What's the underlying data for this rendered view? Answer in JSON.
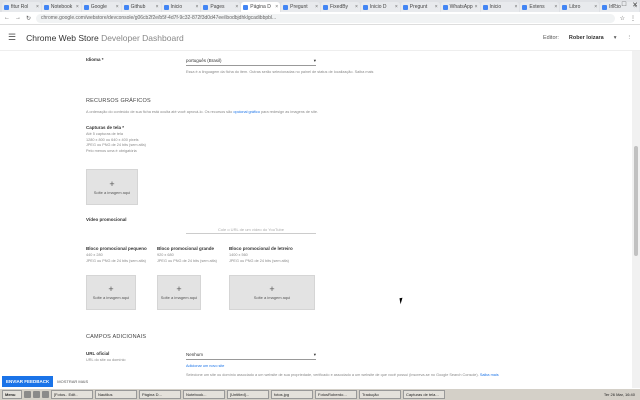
{
  "browser": {
    "tabs": [
      {
        "label": "fitur Rol",
        "active": false
      },
      {
        "label": "Notebook",
        "active": false
      },
      {
        "label": "Google",
        "active": false
      },
      {
        "label": "Github",
        "active": false
      },
      {
        "label": "Inicio",
        "active": false
      },
      {
        "label": "Pages",
        "active": false
      },
      {
        "label": "Página D",
        "active": true
      },
      {
        "label": "Pregunt",
        "active": false
      },
      {
        "label": "FixedBy",
        "active": false
      },
      {
        "label": "Inicio D",
        "active": false
      },
      {
        "label": "Pregunt",
        "active": false
      },
      {
        "label": "WhatsApp",
        "active": false
      },
      {
        "label": "Inicio",
        "active": false
      },
      {
        "label": "Extens",
        "active": false
      },
      {
        "label": "Libro",
        "active": false
      },
      {
        "label": "Inicio",
        "active": false
      }
    ],
    "url": "chrome.google.com/webstore/devconsole/g06cb2f2e/b5f-4d7f-9c32-872f3d0d47ee/ibodbjdhklgcadibbpbl..."
  },
  "header": {
    "app_title": "Chrome Web Store",
    "app_subtitle": "Developer Dashboard",
    "publisher_label": "Editor:",
    "user_name": "Rober loizara",
    "more_icon": "more-vert-icon"
  },
  "language": {
    "label": "Idioma *",
    "value": "português (Brasil)",
    "help": "Essa é a linguagem da ficha do item. Outras serão selecionadas no painel de status de localização. Saiba mais"
  },
  "graphics": {
    "section_title": "RECURSOS GRÁFICOS",
    "hint_prefix": "A ordenação do conteúdo de sua ficha está oculta até você aprová-lo. Os recursos são",
    "hint_link": "opcional gráfico",
    "hint_suffix": "para redesign as imagens de site.",
    "screenshots": {
      "label": "Capturas de tela *",
      "details": [
        "Até 5 capturas de tela",
        "1280 x 800 ou 640 x 400 pixels",
        "JPEG ou PNG de 24 bits (sem alfa)",
        "Pelo menos uma é obrigatória"
      ],
      "upload_label": "Solte a imagem aqui"
    },
    "video": {
      "label": "Vídeo promocional",
      "placeholder": "Cole o URL de um vídeo do YouTube"
    },
    "small_tile": {
      "label": "Bloco promocional pequeno",
      "details": [
        "440 x 280",
        "JPEG ou PNG de 24 bits (sem alfa)"
      ],
      "upload_label": "Solte a imagem aqui"
    },
    "large_tile": {
      "label": "Bloco promocional grande",
      "details": [
        "920 x 680",
        "JPEG ou PNG de 24 bits (sem alfa)"
      ],
      "upload_label": "Solte a imagem aqui"
    },
    "marquee_tile": {
      "label": "Bloco promocional de letreiro",
      "details": [
        "1400 x 560",
        "JPEG ou PNG de 24 bits (sem alfa)"
      ],
      "upload_label": "Solte a imagem aqui"
    }
  },
  "additional": {
    "section_title": "CAMPOS ADICIONAIS",
    "official_url": {
      "label": "URL oficial",
      "detail": "URL do site ou domínio",
      "value": "Nenhum",
      "add_link": "Adicionar um novo site",
      "help_prefix": "Selecione um site ou domínio associado a um website de sua propriedade, verificado e associado a um website de que você possui (inscreva-se no Google Search Console).",
      "help_link": "Saiba mais"
    }
  },
  "feedback": {
    "send_label": "ENVIAR FEEDBACK",
    "dismiss_label": "MOSTRAR MAIS"
  },
  "taskbar": {
    "start": "Menu",
    "items": [
      "[Fotos.. Edit..",
      "Nautilus",
      "Página D...",
      "Notebook...",
      "[Untitled]...",
      "fotos.jpg",
      "FotosRoberdo...",
      "Tradução",
      "Capturas de tela..."
    ],
    "clock": "Ter 26 Mar, 16:40"
  }
}
